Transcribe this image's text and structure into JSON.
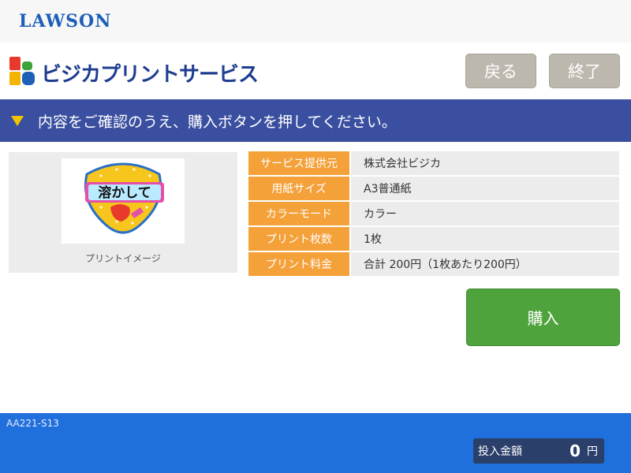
{
  "topbar": {
    "logo_text": "LAWSON"
  },
  "header": {
    "brand_title": "ビジカプリントサービス",
    "back_label": "戻る",
    "end_label": "終了"
  },
  "banner": {
    "message": "内容をご確認のうえ、購入ボタンを押してください。"
  },
  "preview": {
    "image_text": "溶かして",
    "caption": "プリントイメージ"
  },
  "details": [
    {
      "label": "サービス提供元",
      "value": "株式会社ビジカ"
    },
    {
      "label": "用紙サイズ",
      "value": "A3普通紙"
    },
    {
      "label": "カラーモード",
      "value": "カラー"
    },
    {
      "label": "プリント枚数",
      "value": "1枚"
    },
    {
      "label": "プリント料金",
      "value": "合計 200円（1枚あたり200円）"
    }
  ],
  "actions": {
    "buy_label": "購入"
  },
  "footer": {
    "screen_id": "AA221-S13",
    "deposit_label": "投入金額",
    "deposit_amount": "0",
    "deposit_unit": "円"
  },
  "colors": {
    "banner": "#3a4fa0",
    "label_orange": "#f4a13a",
    "buy_green": "#4ea33c",
    "footer_blue": "#1f6fdc",
    "button_gray": "#bdb8ad"
  },
  "icons": {
    "brand": "bizica-b-icon",
    "banner_arrow": "triangle-down-icon"
  }
}
